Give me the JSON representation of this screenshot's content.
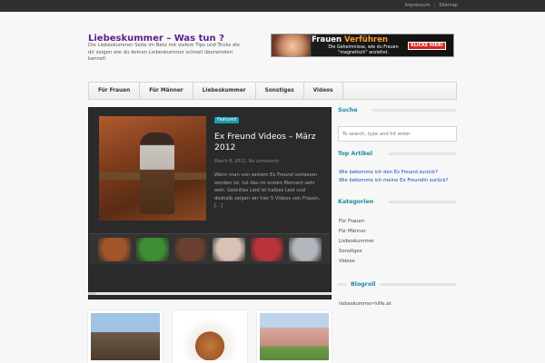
{
  "topbar": {
    "links": [
      "Impressum",
      "Sitemap"
    ],
    "separator": "|"
  },
  "header": {
    "title": "Liebeskummer – Was tun ?",
    "description": "Die Liebeskummer Seite im Netz mit vielem Tips und Tricks die dir zeigen wie du deinen Liebeskummer schnell überwinden kannst!"
  },
  "banner": {
    "word1": "Frauen",
    "word2": "Verführen",
    "tagline": "Die Geheimnisse, wie du Frauen \"magnetisch\" anziehst.",
    "button": "KLICKE HIER!"
  },
  "nav": {
    "items": [
      "Für Frauen",
      "Für Männer",
      "Liebeskummer",
      "Sonstiges",
      "Videos"
    ]
  },
  "featured": {
    "badge": "Featured",
    "title": "Ex Freund Videos – März 2012",
    "meta": "March 8, 2012, No comments",
    "excerpt": "Wenn man von seinem Ex Freund verlassen worden ist, tut das im ersten Moment sehr weh. Geteiltes Leid ist halbes Leid und deshalb zeigen wir hier 5 Videos von Frauen, [...]"
  },
  "thumb_colors": [
    "#a2552a",
    "#3f8d34",
    "#6b4030",
    "#d9c2b5",
    "#b8343a",
    "#b2b5bb"
  ],
  "sidebar": {
    "search_title": "Suche",
    "search_placeholder": "To search, type and hit enter",
    "top_title": "Top Artikel",
    "top_links": [
      "Wie bekomme ich den Ex Freund zurück?",
      "Wie bekomme ich meine Ex Freundin zurück?"
    ],
    "categories_title": "Kategorien",
    "categories": [
      "Für Frauen",
      "Für Männer",
      "Liebeskummer",
      "Sonstiges",
      "Videos"
    ],
    "blogroll_title": "Blogroll",
    "blogroll": [
      "liebeskummer-hilfe.at"
    ]
  },
  "colors": {
    "title": "#5a1f8a",
    "accent": "#1b8aa0",
    "link": "#1f3fb8"
  }
}
